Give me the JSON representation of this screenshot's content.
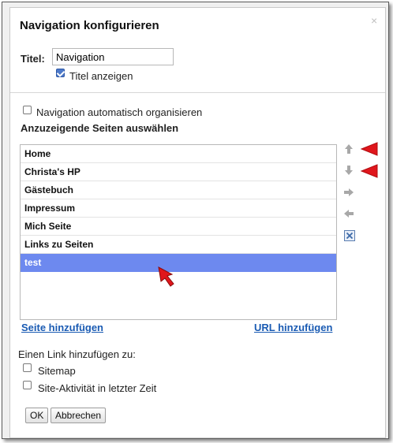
{
  "dialog": {
    "title": "Navigation konfigurieren",
    "close_glyph": "×",
    "title_label": "Titel:",
    "title_value": "Navigation",
    "show_title_label": "Titel anzeigen",
    "show_title_checked": true,
    "auto_organize_label": "Navigation automatisch organisieren",
    "auto_organize_checked": false,
    "pages_heading": "Anzuzeigende Seiten auswählen",
    "pages": [
      "Home",
      "Christa's HP",
      "Gästebuch",
      "Impressum",
      "Mich Seite",
      "Links zu Seiten",
      "test"
    ],
    "selected_page": "test",
    "add_page_link": "Seite hinzufügen",
    "add_url_link": "URL hinzufügen",
    "link_to_label": "Einen Link hinzufügen zu:",
    "sitemap_label": "Sitemap",
    "sitemap_checked": false,
    "activity_label": "Site-Aktivität in letzter Zeit",
    "activity_checked": false,
    "ok_label": "OK",
    "cancel_label": "Abbrechen"
  },
  "icons": {
    "move_up": "arrow-up-icon",
    "move_down": "arrow-down-icon",
    "indent": "arrow-right-icon",
    "outdent": "arrow-left-icon",
    "remove": "remove-x-icon"
  },
  "colors": {
    "selection": "#6d89ef",
    "link": "#1a5bb3",
    "annotation_arrow": "#e0161c",
    "icon_gray": "#a8a8a8"
  }
}
